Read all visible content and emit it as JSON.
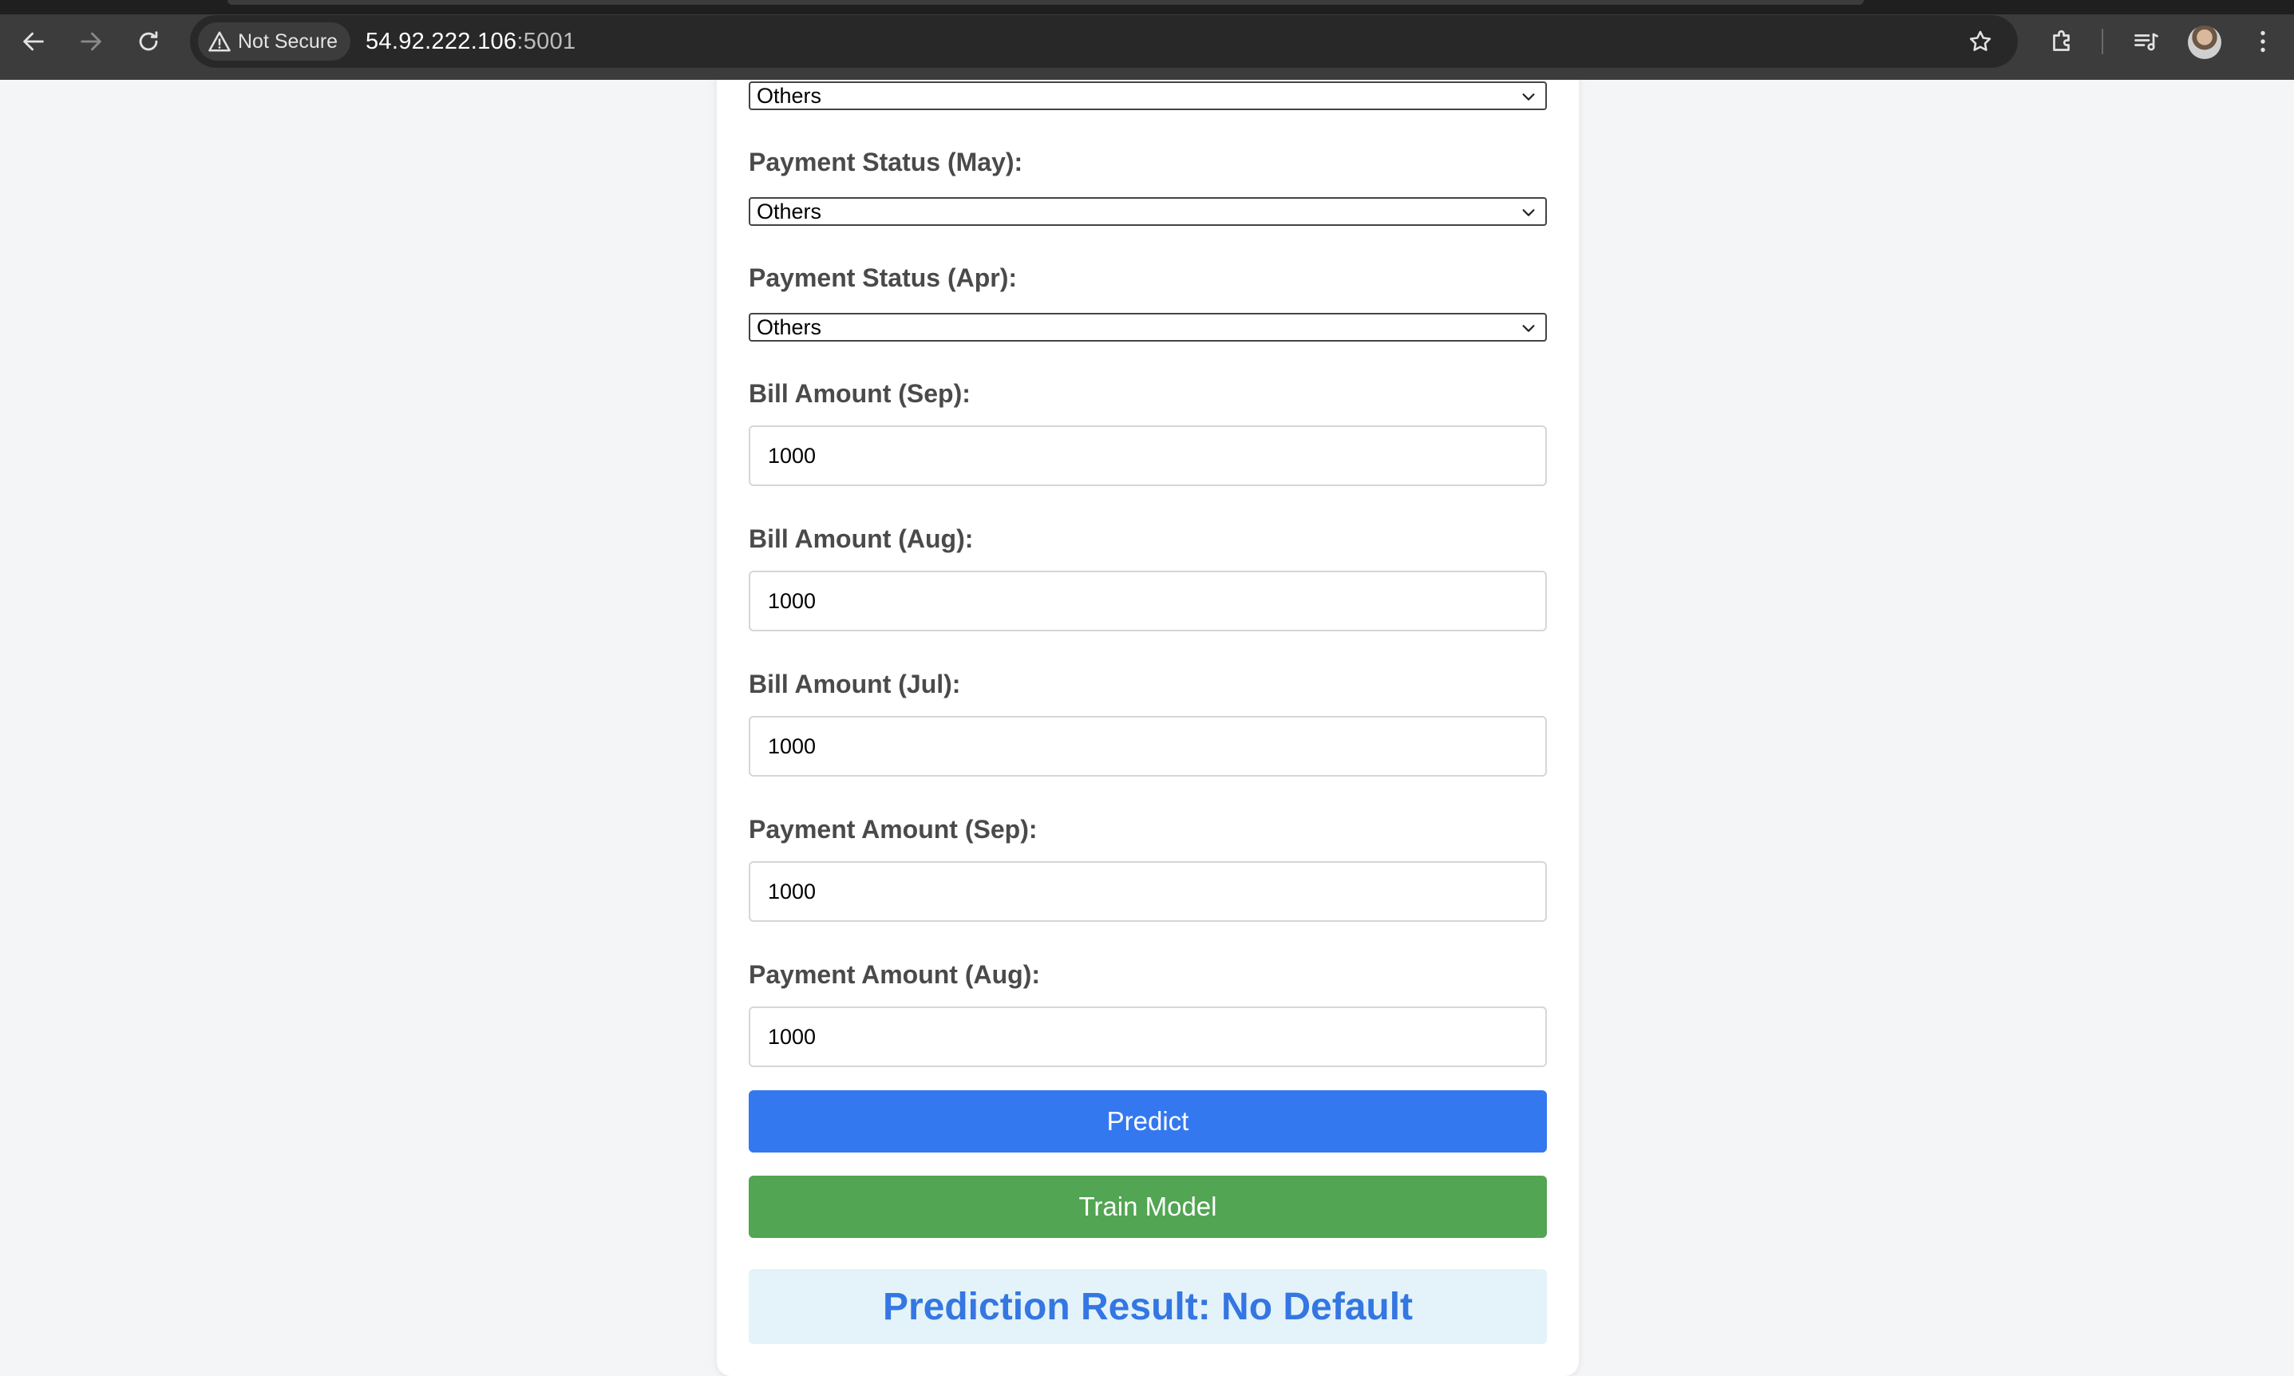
{
  "browser": {
    "security_label": "Not Secure",
    "url_host": "54.92.222.106",
    "url_port": ":5001"
  },
  "form": {
    "top_select_value": "Others",
    "payment_status_may": {
      "label": "Payment Status (May):",
      "value": "Others"
    },
    "payment_status_apr": {
      "label": "Payment Status (Apr):",
      "value": "Others"
    },
    "bill_amount_sep": {
      "label": "Bill Amount (Sep):",
      "value": "1000"
    },
    "bill_amount_aug": {
      "label": "Bill Amount (Aug):",
      "value": "1000"
    },
    "bill_amount_jul": {
      "label": "Bill Amount (Jul):",
      "value": "1000"
    },
    "payment_amount_sep": {
      "label": "Payment Amount (Sep):",
      "value": "1000"
    },
    "payment_amount_aug": {
      "label": "Payment Amount (Aug):",
      "value": "1000"
    },
    "predict_label": "Predict",
    "train_label": "Train Model",
    "result_text": "Prediction Result: No Default"
  },
  "colors": {
    "predict_button": "#3478f0",
    "train_button": "#52a552",
    "result_text": "#3476e2",
    "result_background": "#e3f3f9"
  },
  "icons": {
    "back": "arrow-left-icon",
    "forward": "arrow-right-icon",
    "reload": "reload-icon",
    "security": "warning-triangle-icon",
    "bookmark": "star-icon",
    "extensions": "puzzle-icon",
    "media": "media-queue-icon",
    "menu": "kebab-menu-icon"
  }
}
